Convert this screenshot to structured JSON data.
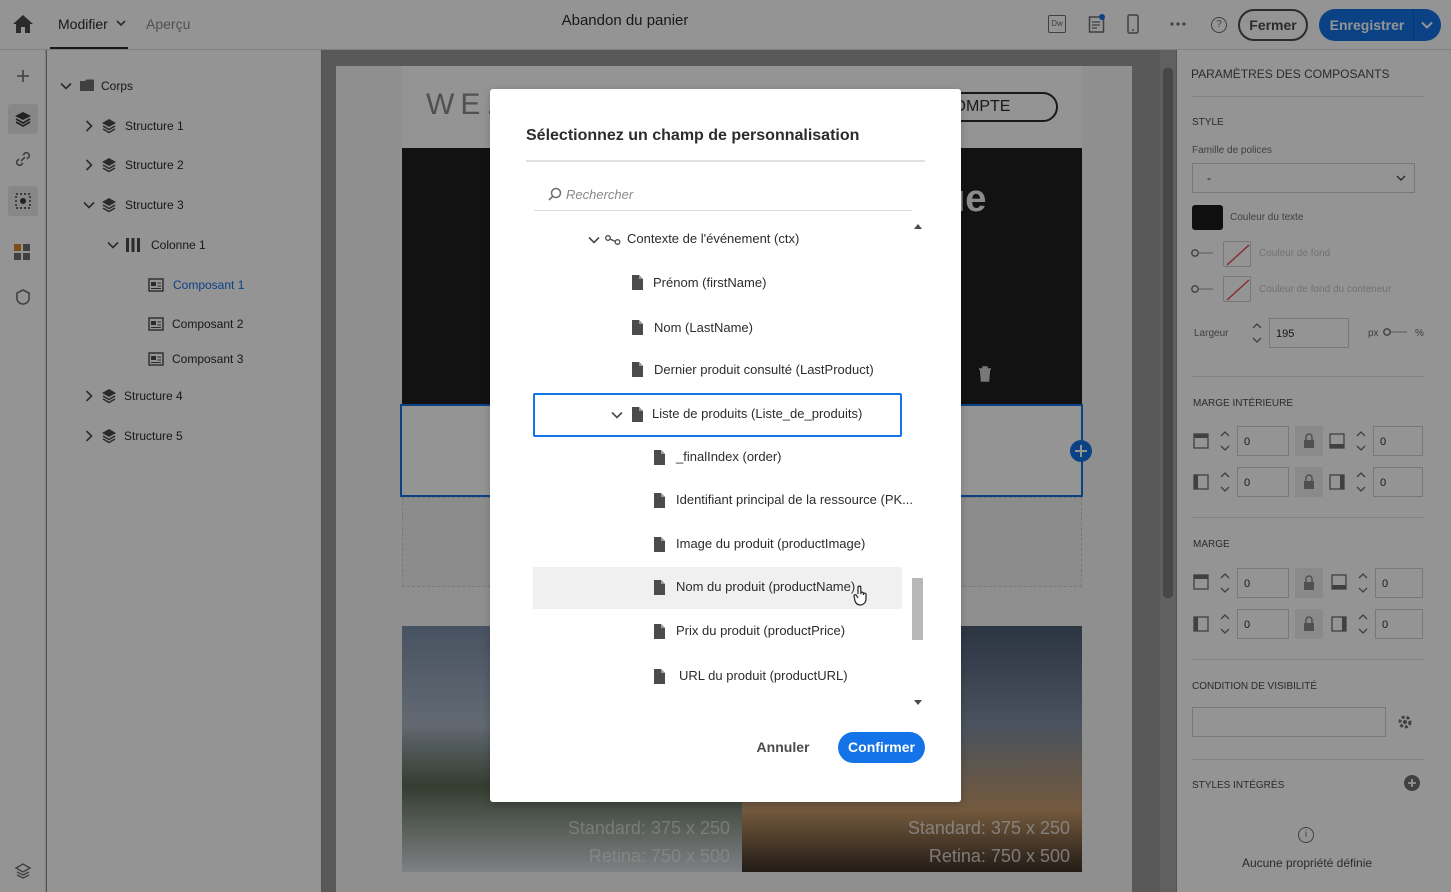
{
  "topbar": {
    "tab_edit": "Modifier",
    "tab_preview": "Aperçu",
    "title": "Abandon du panier",
    "close_label": "Fermer",
    "save_label": "Enregistrer"
  },
  "tree": {
    "items": [
      {
        "label": "Corps",
        "level": 0,
        "icon": "folder-icon",
        "expanded": true
      },
      {
        "label": "Structure 1",
        "level": 1,
        "icon": "layers-icon",
        "expanded": false
      },
      {
        "label": "Structure 2",
        "level": 1,
        "icon": "layers-icon",
        "expanded": false
      },
      {
        "label": "Structure 3",
        "level": 1,
        "icon": "layers-icon",
        "expanded": true
      },
      {
        "label": "Colonne 1",
        "level": 2,
        "icon": "columns-icon",
        "expanded": true
      },
      {
        "label": "Composant 1",
        "level": 3,
        "icon": "component-icon",
        "selected": true
      },
      {
        "label": "Composant 2",
        "level": 3,
        "icon": "component-icon"
      },
      {
        "label": "Composant 3",
        "level": 3,
        "icon": "component-icon"
      },
      {
        "label": "Structure 4",
        "level": 1,
        "icon": "layers-icon",
        "expanded": false
      },
      {
        "label": "Structure 5",
        "level": 1,
        "icon": "layers-icon",
        "expanded": false
      }
    ]
  },
  "canvas": {
    "brand_partial": "WE.",
    "account_partial": "COMPTE",
    "heading_partial": "ue",
    "image_placeholder_std": "Standard: 375 x 250",
    "image_placeholder_retina": "Retina: 750 x 500"
  },
  "right_panel": {
    "title": "PARAMÈTRES DES COMPOSANTS",
    "style_header": "STYLE",
    "font_family_label": "Famille de polices",
    "font_family_value": "-",
    "text_color_label": "Couleur du texte",
    "text_color": "#1b1b1b",
    "bg_color_label": "Couleur de fond",
    "container_bg_label": "Couleur de fond du conteneur",
    "width_label": "Largeur",
    "width_value": "195",
    "width_unit_px": "px",
    "width_unit_pct": "%",
    "padding_header": "MARGE INTÉRIEURE",
    "padding_values": [
      "0",
      "0",
      "0",
      "0"
    ],
    "margin_header": "MARGE",
    "margin_values": [
      "0",
      "0",
      "0",
      "0"
    ],
    "visibility_header": "CONDITION DE VISIBILITÉ",
    "inline_styles_header": "STYLES INTÉGRÉS",
    "no_property": "Aucune propriété définie"
  },
  "modal": {
    "title": "Sélectionnez un champ de personnalisation",
    "search_placeholder": "Rechercher",
    "fields": [
      {
        "label": "Contexte de l'événement (ctx)",
        "icon": "link-icon",
        "expanded": true
      },
      {
        "label": "Prénom (firstName)",
        "icon": "document-icon"
      },
      {
        "label": "Nom (LastName)",
        "icon": "document-icon"
      },
      {
        "label": "Dernier produit consulté (LastProduct)",
        "icon": "document-icon"
      },
      {
        "label": "Liste de produits (Liste_de_produits)",
        "icon": "document-icon",
        "expanded": true,
        "focused": true
      },
      {
        "label": "_finalIndex (order)",
        "icon": "document-icon"
      },
      {
        "label": "Identifiant principal de la ressource (PK...",
        "icon": "document-icon"
      },
      {
        "label": "Image du produit (productImage)",
        "icon": "document-icon"
      },
      {
        "label": "Nom du produit (productName)",
        "icon": "document-icon",
        "hover": true
      },
      {
        "label": "Prix du produit (productPrice)",
        "icon": "document-icon"
      },
      {
        "label": "URL du produit (productURL)",
        "icon": "document-icon"
      }
    ],
    "cancel_label": "Annuler",
    "confirm_label": "Confirmer"
  },
  "colors": {
    "accent": "#1473e6",
    "text": "#2c2c2c"
  }
}
